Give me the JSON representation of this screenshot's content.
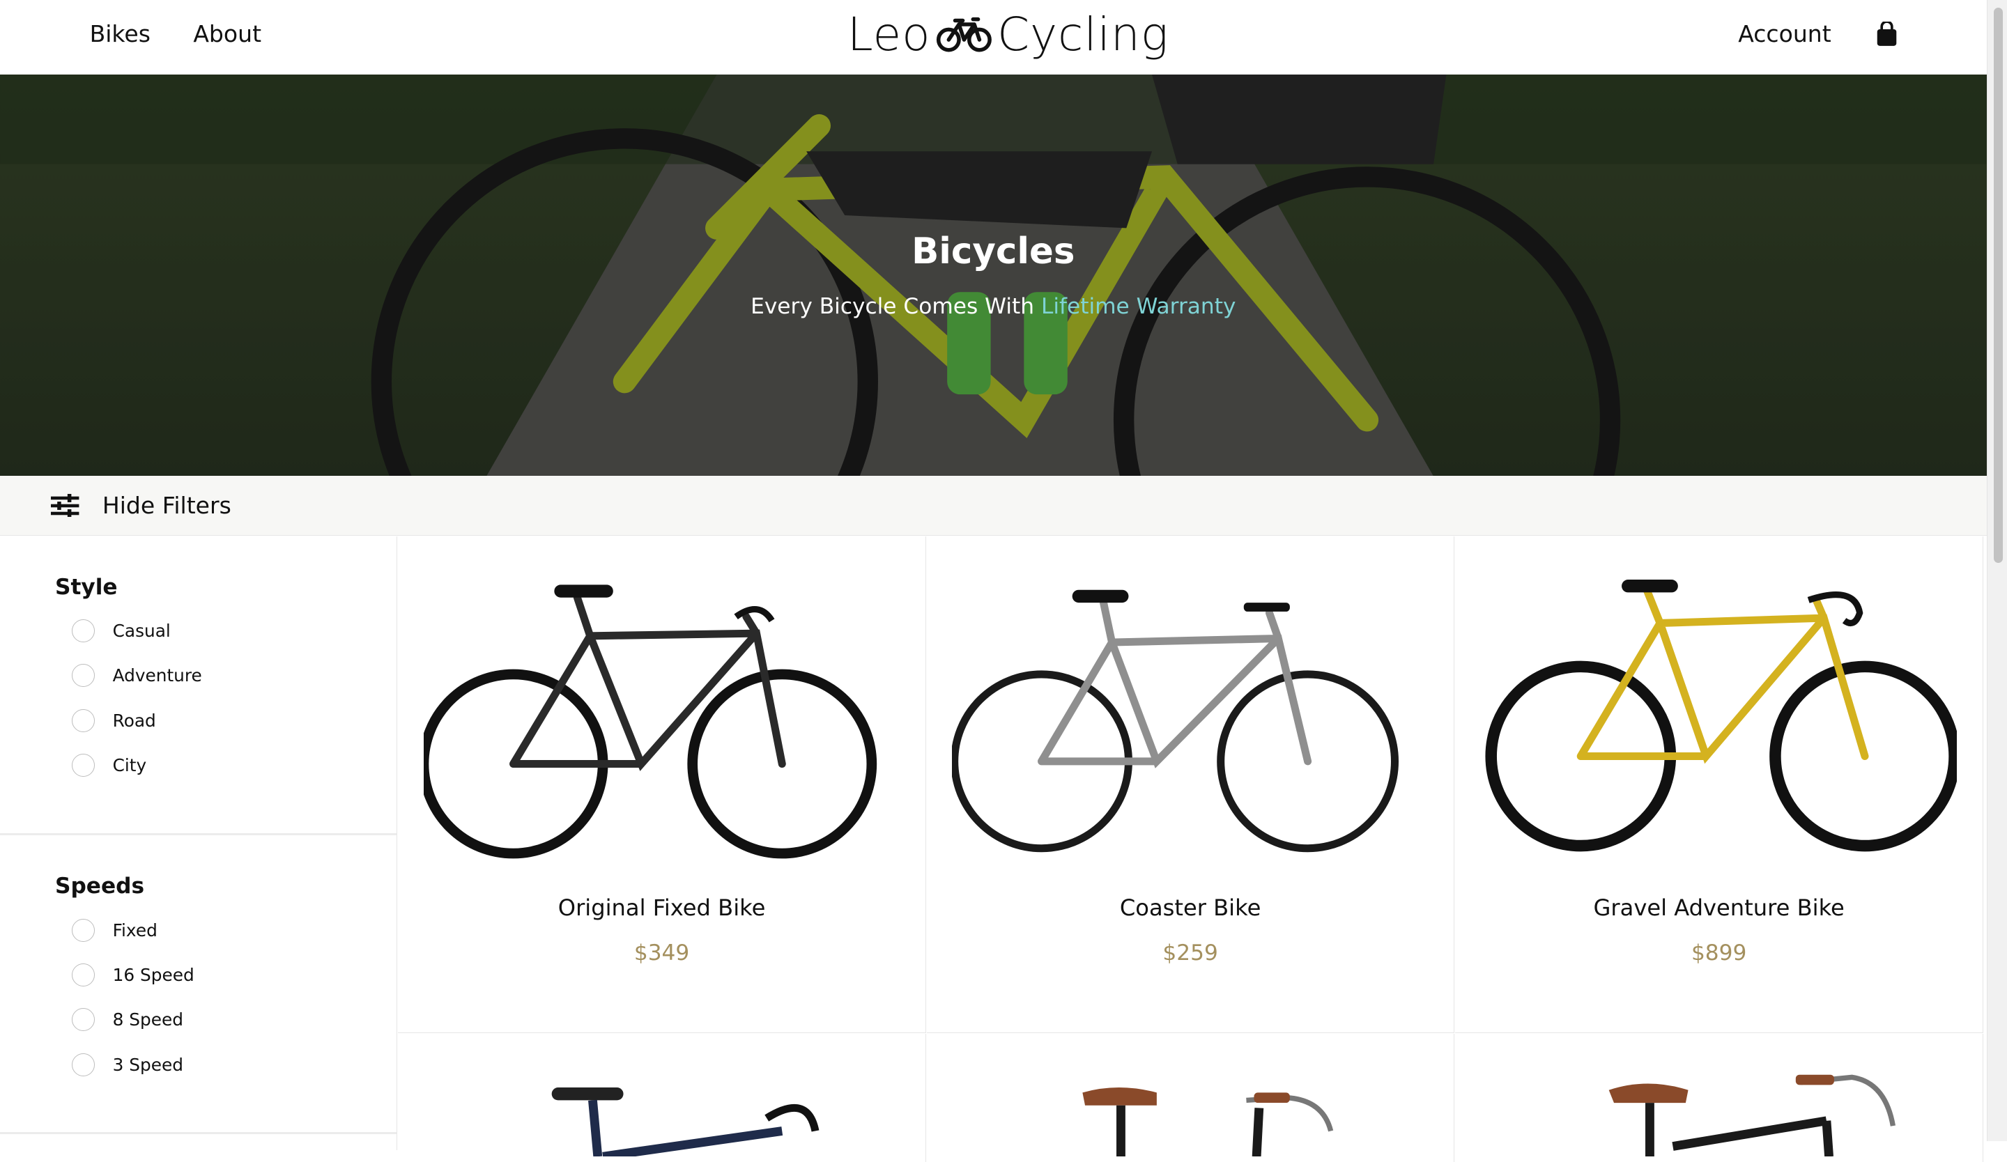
{
  "header": {
    "nav": [
      {
        "label": "Bikes"
      },
      {
        "label": "About"
      }
    ],
    "logo": {
      "left": "Leo",
      "right": "Cycling",
      "icon": "bicycle-icon"
    },
    "account_label": "Account",
    "cart_icon": "shopping-bag-icon"
  },
  "hero": {
    "title": "Bicycles",
    "subtitle_prefix": "Every Bicycle Comes With ",
    "subtitle_link": "Lifetime Warranty",
    "accent_color": "#7fd3d5"
  },
  "filterbar": {
    "toggle_label": "Hide Filters",
    "icon": "sliders-icon"
  },
  "filters": [
    {
      "title": "Style",
      "options": [
        "Casual",
        "Adventure",
        "Road",
        "City"
      ]
    },
    {
      "title": "Speeds",
      "options": [
        "Fixed",
        "16 Speed",
        "8 Speed",
        "3 Speed"
      ]
    }
  ],
  "products": [
    {
      "name": "Original Fixed Bike",
      "price": "$349",
      "frame_color": "#2a2a2a"
    },
    {
      "name": "Coaster Bike",
      "price": "$259",
      "frame_color": "#8f8f8f"
    },
    {
      "name": "Gravel Adventure Bike",
      "price": "$899",
      "frame_color": "#d4b21f"
    }
  ],
  "products_row2": [
    {
      "frame_color": "#1f2b4a",
      "saddle_color": "#222222"
    },
    {
      "frame_color": "#1a1a1a",
      "saddle_color": "#8a4a2a"
    },
    {
      "frame_color": "#1a1a1a",
      "saddle_color": "#8a4a2a"
    }
  ],
  "colors": {
    "price": "#a4905e",
    "filterbar_bg": "#f7f7f5"
  }
}
